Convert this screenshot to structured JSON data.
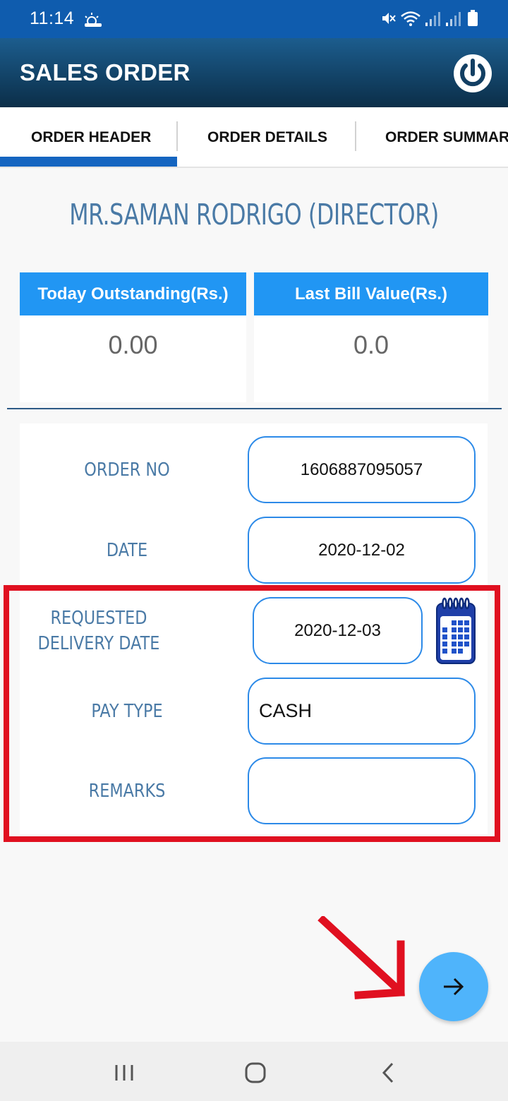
{
  "status_bar": {
    "time": "11:14",
    "icons": [
      "weather-sun-cloud-icon",
      "mute-icon",
      "wifi-icon",
      "signal-icon",
      "signal-icon",
      "battery-icon"
    ]
  },
  "app_bar": {
    "title": "SALES ORDER",
    "power_icon": "power-icon"
  },
  "tabs": [
    {
      "label": "ORDER HEADER",
      "selected": true
    },
    {
      "label": "ORDER DETAILS",
      "selected": false
    },
    {
      "label": "ORDER SUMMARY",
      "selected": false
    }
  ],
  "customer": {
    "name": "MR.SAMAN RODRIGO (DIRECTOR)"
  },
  "stats": [
    {
      "label": "Today Outstanding(Rs.)",
      "value": "0.00"
    },
    {
      "label": "Last Bill Value(Rs.)",
      "value": "0.0"
    }
  ],
  "form": {
    "order_no_label": "ORDER NO",
    "order_no_value": "1606887095057",
    "date_label": "DATE",
    "date_value": "2020-12-02",
    "requested_delivery_label_line1": "REQUESTED",
    "requested_delivery_label_line2": "DELIVERY DATE",
    "requested_delivery_value": "2020-12-03",
    "pay_type_label": "PAY TYPE",
    "pay_type_value": "CASH",
    "remarks_label": "REMARKS",
    "remarks_value": ""
  },
  "colors": {
    "status_bar": "#0f5cae",
    "app_bar": "#123f63",
    "tab_indicator": "#1565c0",
    "card_header": "#2196f3",
    "label_text": "#4a7aa6",
    "field_border": "#2c8ae8",
    "highlight": "#e01020",
    "fab": "#4fb4fb"
  },
  "icons": {
    "calendar": "calendar-icon",
    "next": "arrow-right-icon",
    "annotation": "red-arrow-icon",
    "nav_recents": "recents-icon",
    "nav_home": "home-icon",
    "nav_back": "back-icon"
  }
}
